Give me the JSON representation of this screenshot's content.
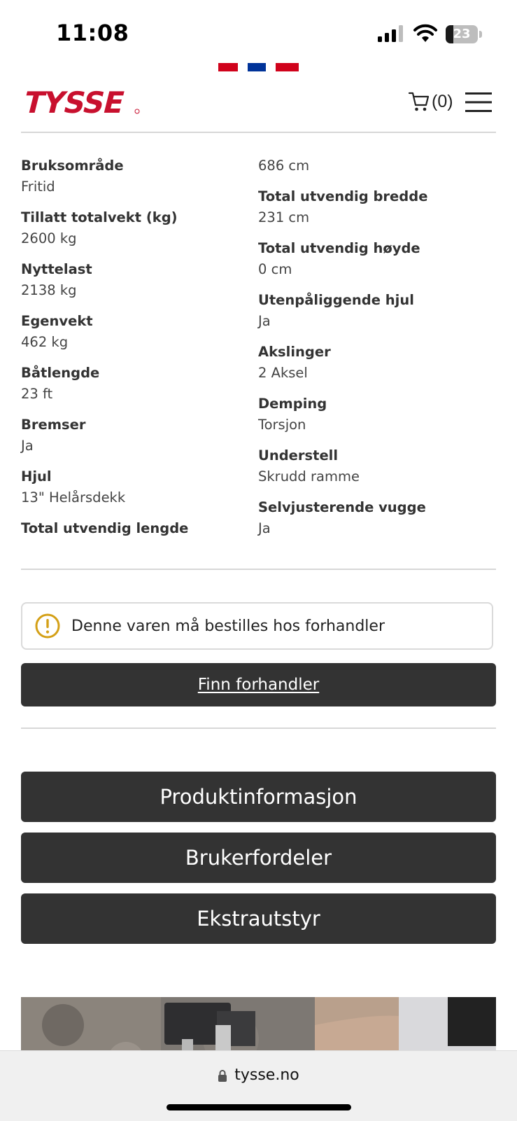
{
  "status_bar": {
    "time": "11:08",
    "battery_level": "23",
    "icons": [
      "signal-icon",
      "wifi-icon",
      "battery-icon"
    ]
  },
  "flag_colors": [
    "#d0021b",
    "#ffffff",
    "#003399",
    "#ffffff",
    "#d0021b"
  ],
  "header": {
    "logo_text": "TYSSE",
    "logo_color": "#c8102e",
    "cart_count": "(0)"
  },
  "specs": {
    "left": [
      {
        "label": "Bruksområde",
        "value": "Fritid"
      },
      {
        "label": "Tillatt totalvekt (kg)",
        "value": "2600 kg"
      },
      {
        "label": "Nyttelast",
        "value": "2138 kg"
      },
      {
        "label": "Egenvekt",
        "value": "462 kg"
      },
      {
        "label": "Båtlengde",
        "value": "23 ft"
      },
      {
        "label": "Bremser",
        "value": "Ja"
      },
      {
        "label": "Hjul",
        "value": "13\" Helårsdekk"
      },
      {
        "label": "Total utvendig lengde",
        "value": ""
      }
    ],
    "right_top_value": "686 cm",
    "right": [
      {
        "label": "Total utvendig bredde",
        "value": "231 cm"
      },
      {
        "label": "Total utvendig høyde",
        "value": "0 cm"
      },
      {
        "label": "Utenpåliggende hjul",
        "value": "Ja"
      },
      {
        "label": "Akslinger",
        "value": "2 Aksel"
      },
      {
        "label": "Demping",
        "value": "Torsjon"
      },
      {
        "label": "Understell",
        "value": "Skrudd ramme"
      },
      {
        "label": "Selvjusterende vugge",
        "value": "Ja"
      }
    ]
  },
  "notice": {
    "text": "Denne varen må bestilles hos forhandler",
    "icon": "warning-icon",
    "icon_color": "#d4a017"
  },
  "buttons": {
    "find_dealer": "Finn forhandler",
    "product_info": "Produktinformasjon",
    "user_benefits": "Brukerfordeler",
    "extras": "Ekstrautstyr"
  },
  "browser": {
    "url": "tysse.no"
  },
  "colors": {
    "button_bg": "#333333",
    "brand_red": "#c8102e"
  }
}
